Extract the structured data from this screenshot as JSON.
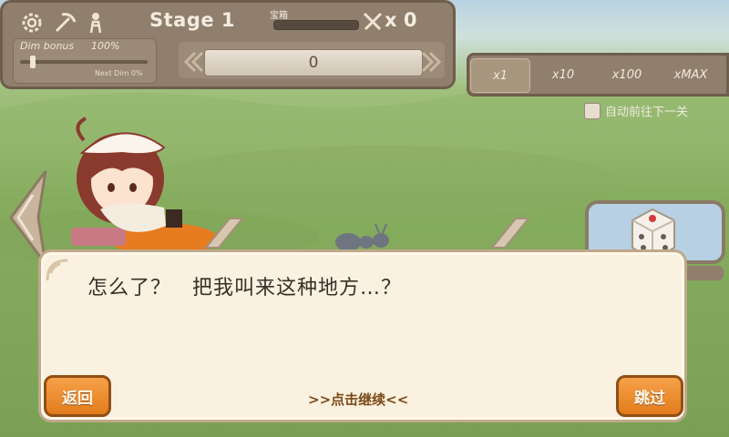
{
  "header": {
    "stage_title": "Stage 1",
    "chest_label": "宝箱",
    "sword_count": "x 0",
    "dim_bonus_label": "Dim bonus",
    "dim_bonus_value": "100%",
    "next_dim_label": "Next Dim 0%",
    "counter_value": "0",
    "dim_slider_level_percent": 8,
    "chest_progress_percent": 0
  },
  "icons": [
    "gear-icon",
    "pickaxe-icon",
    "character-icon",
    "crossed-swords-icon",
    "dice-icon"
  ],
  "multipliers": {
    "options": [
      "x1",
      "x10",
      "x100",
      "xMAX"
    ],
    "selected": "x1"
  },
  "auto_advance": {
    "label": "自动前往下一关",
    "checked": false
  },
  "dialog": {
    "text": "怎么了？　把我叫来这种地方…？",
    "continue_hint": ">>点击继续<<",
    "back_label": "返回",
    "skip_label": "跳过"
  },
  "colors": {
    "panel": "#8f7f6c",
    "panel_border": "#6d5e4d",
    "dialog_bg": "#fbf1e0",
    "button_orange": "#f0902f"
  }
}
